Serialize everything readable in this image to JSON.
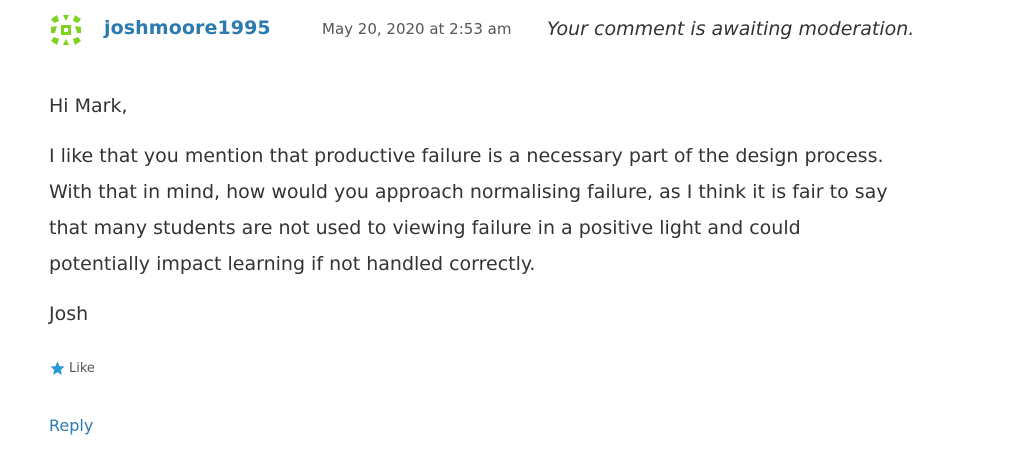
{
  "comment": {
    "author": "joshmoore1995",
    "date": "May 20, 2020 at 2:53 am",
    "moderation_notice": "Your comment is awaiting moderation.",
    "avatar_icon": "identicon-avatar",
    "avatar_color": "#7ed321",
    "greeting": "Hi Mark,",
    "body_lines": [
      "I like that you mention that productive failure is a necessary part of the design process.",
      "With that in mind, how would you approach normalising failure, as I think it is fair to say",
      "that many students are not used to viewing failure in a positive light and could",
      "potentially impact learning if not handled correctly."
    ],
    "signoff": "Josh",
    "like_label": "Like",
    "like_icon": "star-icon",
    "reply_label": "Reply"
  },
  "colors": {
    "link": "#2b7bb0",
    "star": "#2b9bd8",
    "text": "#333333"
  }
}
